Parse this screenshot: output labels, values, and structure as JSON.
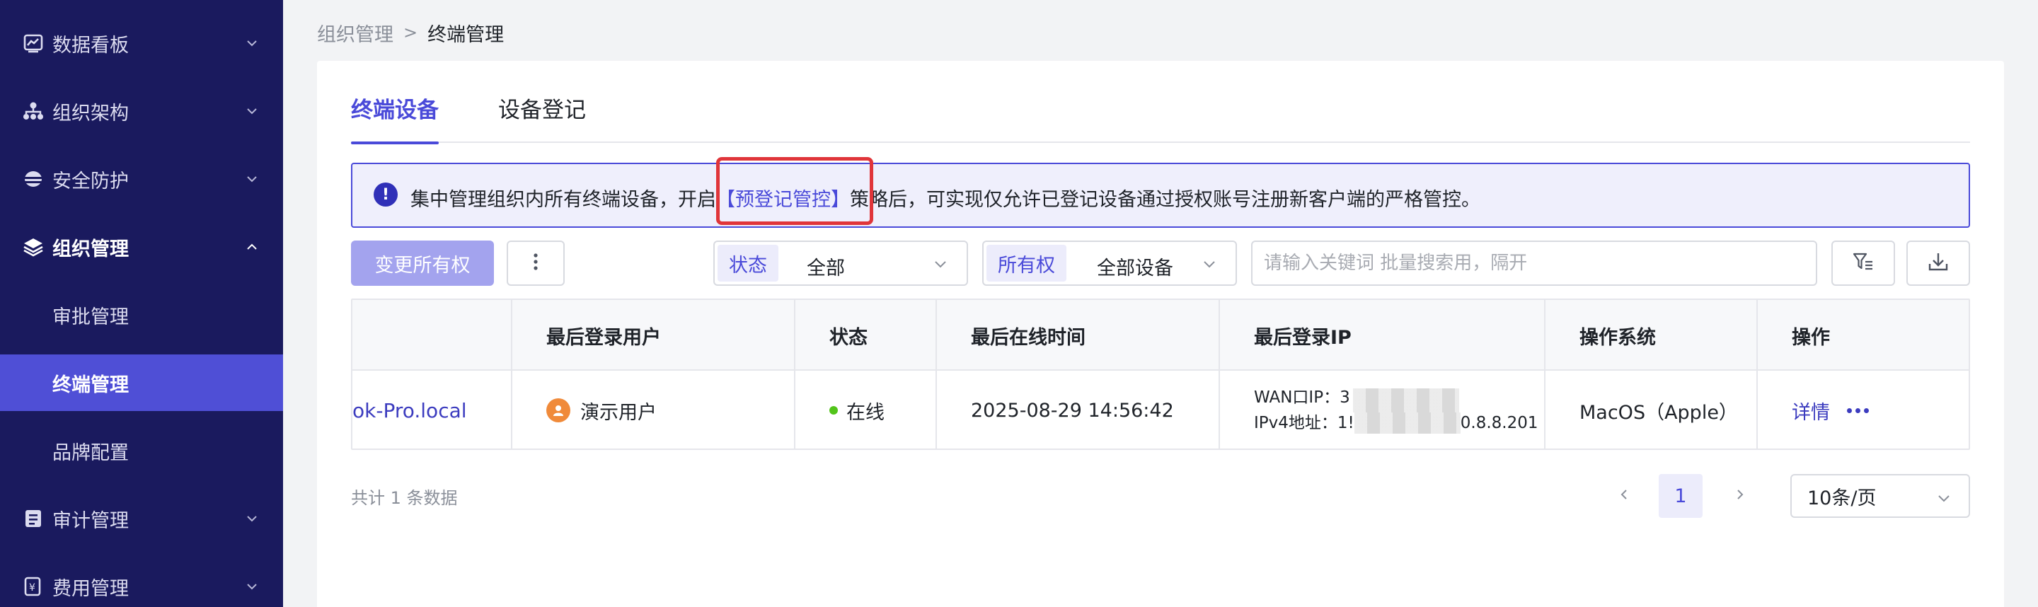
{
  "sidebar": {
    "items": [
      {
        "label": "数据看板",
        "icon": "chart-icon",
        "expanded": false
      },
      {
        "label": "组织架构",
        "icon": "org-tree-icon",
        "expanded": false
      },
      {
        "label": "安全防护",
        "icon": "shield-icon",
        "expanded": false
      },
      {
        "label": "组织管理",
        "icon": "layers-icon",
        "expanded": true,
        "children": [
          {
            "label": "审批管理"
          },
          {
            "label": "终端管理",
            "active": true
          },
          {
            "label": "品牌配置"
          }
        ]
      },
      {
        "label": "审计管理",
        "icon": "audit-icon",
        "expanded": false
      },
      {
        "label": "费用管理",
        "icon": "billing-icon",
        "expanded": false
      }
    ]
  },
  "breadcrumb": {
    "parent": "组织管理",
    "separator": ">",
    "current": "终端管理"
  },
  "tabs": [
    {
      "label": "终端设备",
      "active": true
    },
    {
      "label": "设备登记",
      "active": false
    }
  ],
  "alert": {
    "icon": "exclamation-icon",
    "text_before": "集中管理组织内所有终端设备，开启",
    "link": "【预登记管控】",
    "text_after": "策略后，可实现仅允许已登记设备通过授权账号注册新客户端的严格管控。"
  },
  "toolbar": {
    "change_owner_label": "变更所有权",
    "more_icon": "vertical-dots-icon",
    "status_filter": {
      "label": "状态",
      "value": "全部"
    },
    "ownership_filter": {
      "label": "所有权",
      "value": "全部设备"
    },
    "search_placeholder": "请输入关键词 批量搜索用，隔开",
    "filter_icon": "filter-icon",
    "download_icon": "download-icon"
  },
  "table": {
    "columns": [
      "最后登录用户",
      "状态",
      "最后在线时间",
      "最后登录IP",
      "操作系统",
      "操作"
    ],
    "rows": [
      {
        "device": "ok-Pro.local",
        "user": "演示用户",
        "status": "在线",
        "last_online": "2025-08-29 14:56:42",
        "wan_label": "WAN口IP：3",
        "ipv4_label": "IPv4地址：1!",
        "ipv4_suffix": "0.8.8.201",
        "os": "MacOS（Apple）",
        "detail_label": "详情"
      }
    ]
  },
  "footer": {
    "total": "共计 1 条数据",
    "current_page": "1",
    "page_size": "10条/页"
  },
  "colors": {
    "sidebar_bg": "#1a1a5e",
    "accent": "#4a4ad9",
    "active_menu": "#4f4fd6",
    "highlight_border": "#e0353a",
    "online": "#52c41a"
  }
}
